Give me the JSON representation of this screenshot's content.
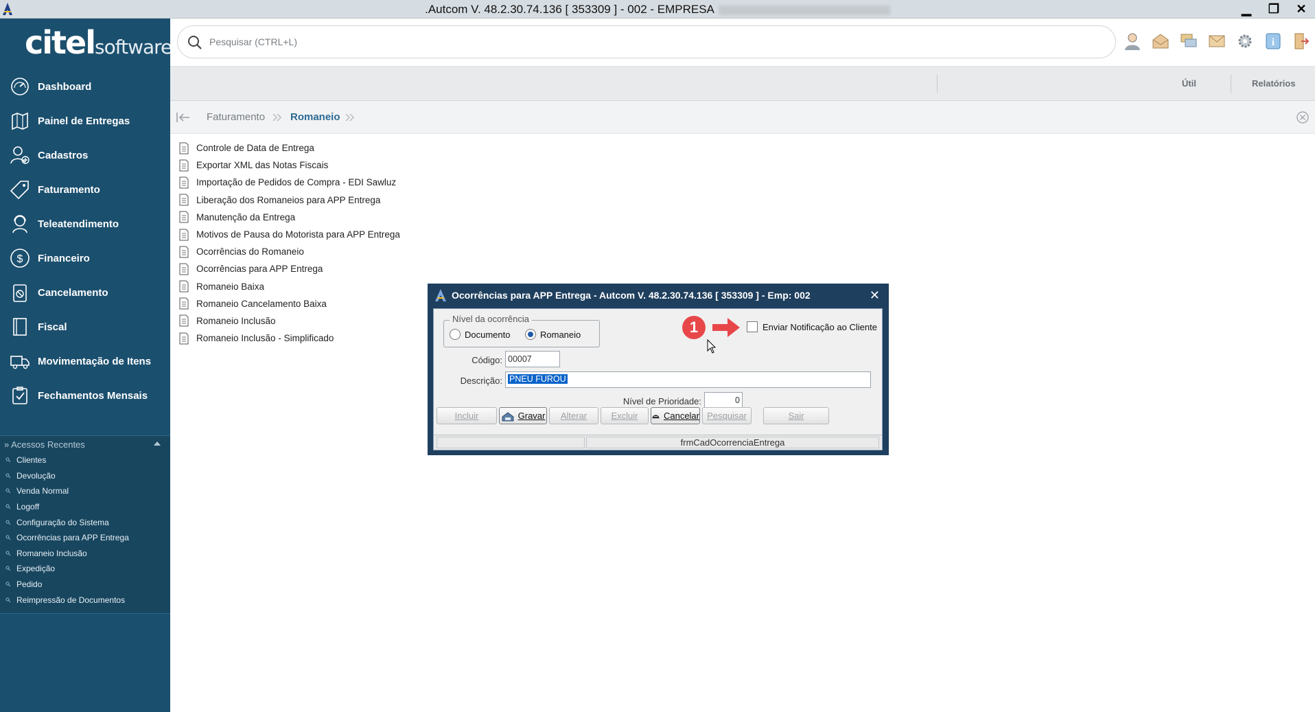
{
  "window": {
    "title": ".Autcom V. 48.2.30.74.136 [ 353309 ] - 002 - EMPRESA",
    "minimize": "▁",
    "restore": "❐",
    "close": "✕"
  },
  "sidebar": {
    "logo_bold": "citel",
    "logo_light": "software",
    "items": [
      {
        "label": "Dashboard",
        "icon": "gauge-icon"
      },
      {
        "label": "Painel de Entregas",
        "icon": "map-icon"
      },
      {
        "label": "Cadastros",
        "icon": "user-add-icon"
      },
      {
        "label": "Faturamento",
        "icon": "tag-icon"
      },
      {
        "label": "Teleatendimento",
        "icon": "headset-icon"
      },
      {
        "label": "Financeiro",
        "icon": "dollar-icon"
      },
      {
        "label": "Cancelamento",
        "icon": "cancel-clipboard-icon"
      },
      {
        "label": "Fiscal",
        "icon": "book-icon"
      },
      {
        "label": "Movimentação de Itens",
        "icon": "truck-icon"
      },
      {
        "label": "Fechamentos Mensais",
        "icon": "checklist-icon"
      }
    ],
    "recent": {
      "header": "» Acessos Recentes",
      "items": [
        "Clientes",
        "Devolução",
        "Venda Normal",
        "Logoff",
        "Configuração do Sistema",
        "Ocorrências para APP Entrega",
        "Romaneio Inclusão",
        "Expedição",
        "Pedido",
        "Reimpressão de Documentos"
      ]
    }
  },
  "search": {
    "placeholder": "Pesquisar (CTRL+L)"
  },
  "menubar": {
    "util": "Útil",
    "relatorios": "Relatórios"
  },
  "breadcrumb": {
    "level1": "Faturamento",
    "level2": "Romaneio"
  },
  "list": [
    "Controle de Data de Entrega",
    "Exportar XML das Notas Fiscais",
    "Importação de Pedidos de Compra - EDI Sawluz",
    "Liberação dos Romaneios para APP Entrega",
    "Manutenção da Entrega",
    "Motivos de Pausa do Motorista para APP Entrega",
    "Ocorrências do Romaneio",
    "Ocorrências para APP Entrega",
    "Romaneio Baixa",
    "Romaneio Cancelamento Baixa",
    "Romaneio Inclusão",
    "Romaneio Inclusão - Simplificado"
  ],
  "dialog": {
    "title": "Ocorrências para APP Entrega   -   Autcom V. 48.2.30.74.136 [ 353309 ] - Emp: 002",
    "close": "✕",
    "nivel_legend": "Nível da ocorrência",
    "radio_documento": "Documento",
    "radio_romaneio": "Romaneio",
    "selected_radio": "Romaneio",
    "step_badge": "1",
    "notify_label": "Enviar Notificação ao Cliente",
    "codigo_label": "Código:",
    "codigo_value": "00007",
    "descricao_label": "Descrição:",
    "descricao_value": "PNEU FUROU",
    "prioridade_label": "Nível de Prioridade:",
    "prioridade_value": "0",
    "buttons": {
      "incluir": "Incluir",
      "gravar": "Gravar",
      "alterar": "Alterar",
      "excluir": "Excluir",
      "cancelar": "Cancelar",
      "pesquisar": "Pesquisar",
      "sair": "Sair"
    },
    "status_form": "frmCadOcorrenciaEntrega"
  },
  "colors": {
    "sidebar": "#1b4f6e",
    "accent": "#2c6a93",
    "badge": "#e8474a"
  }
}
